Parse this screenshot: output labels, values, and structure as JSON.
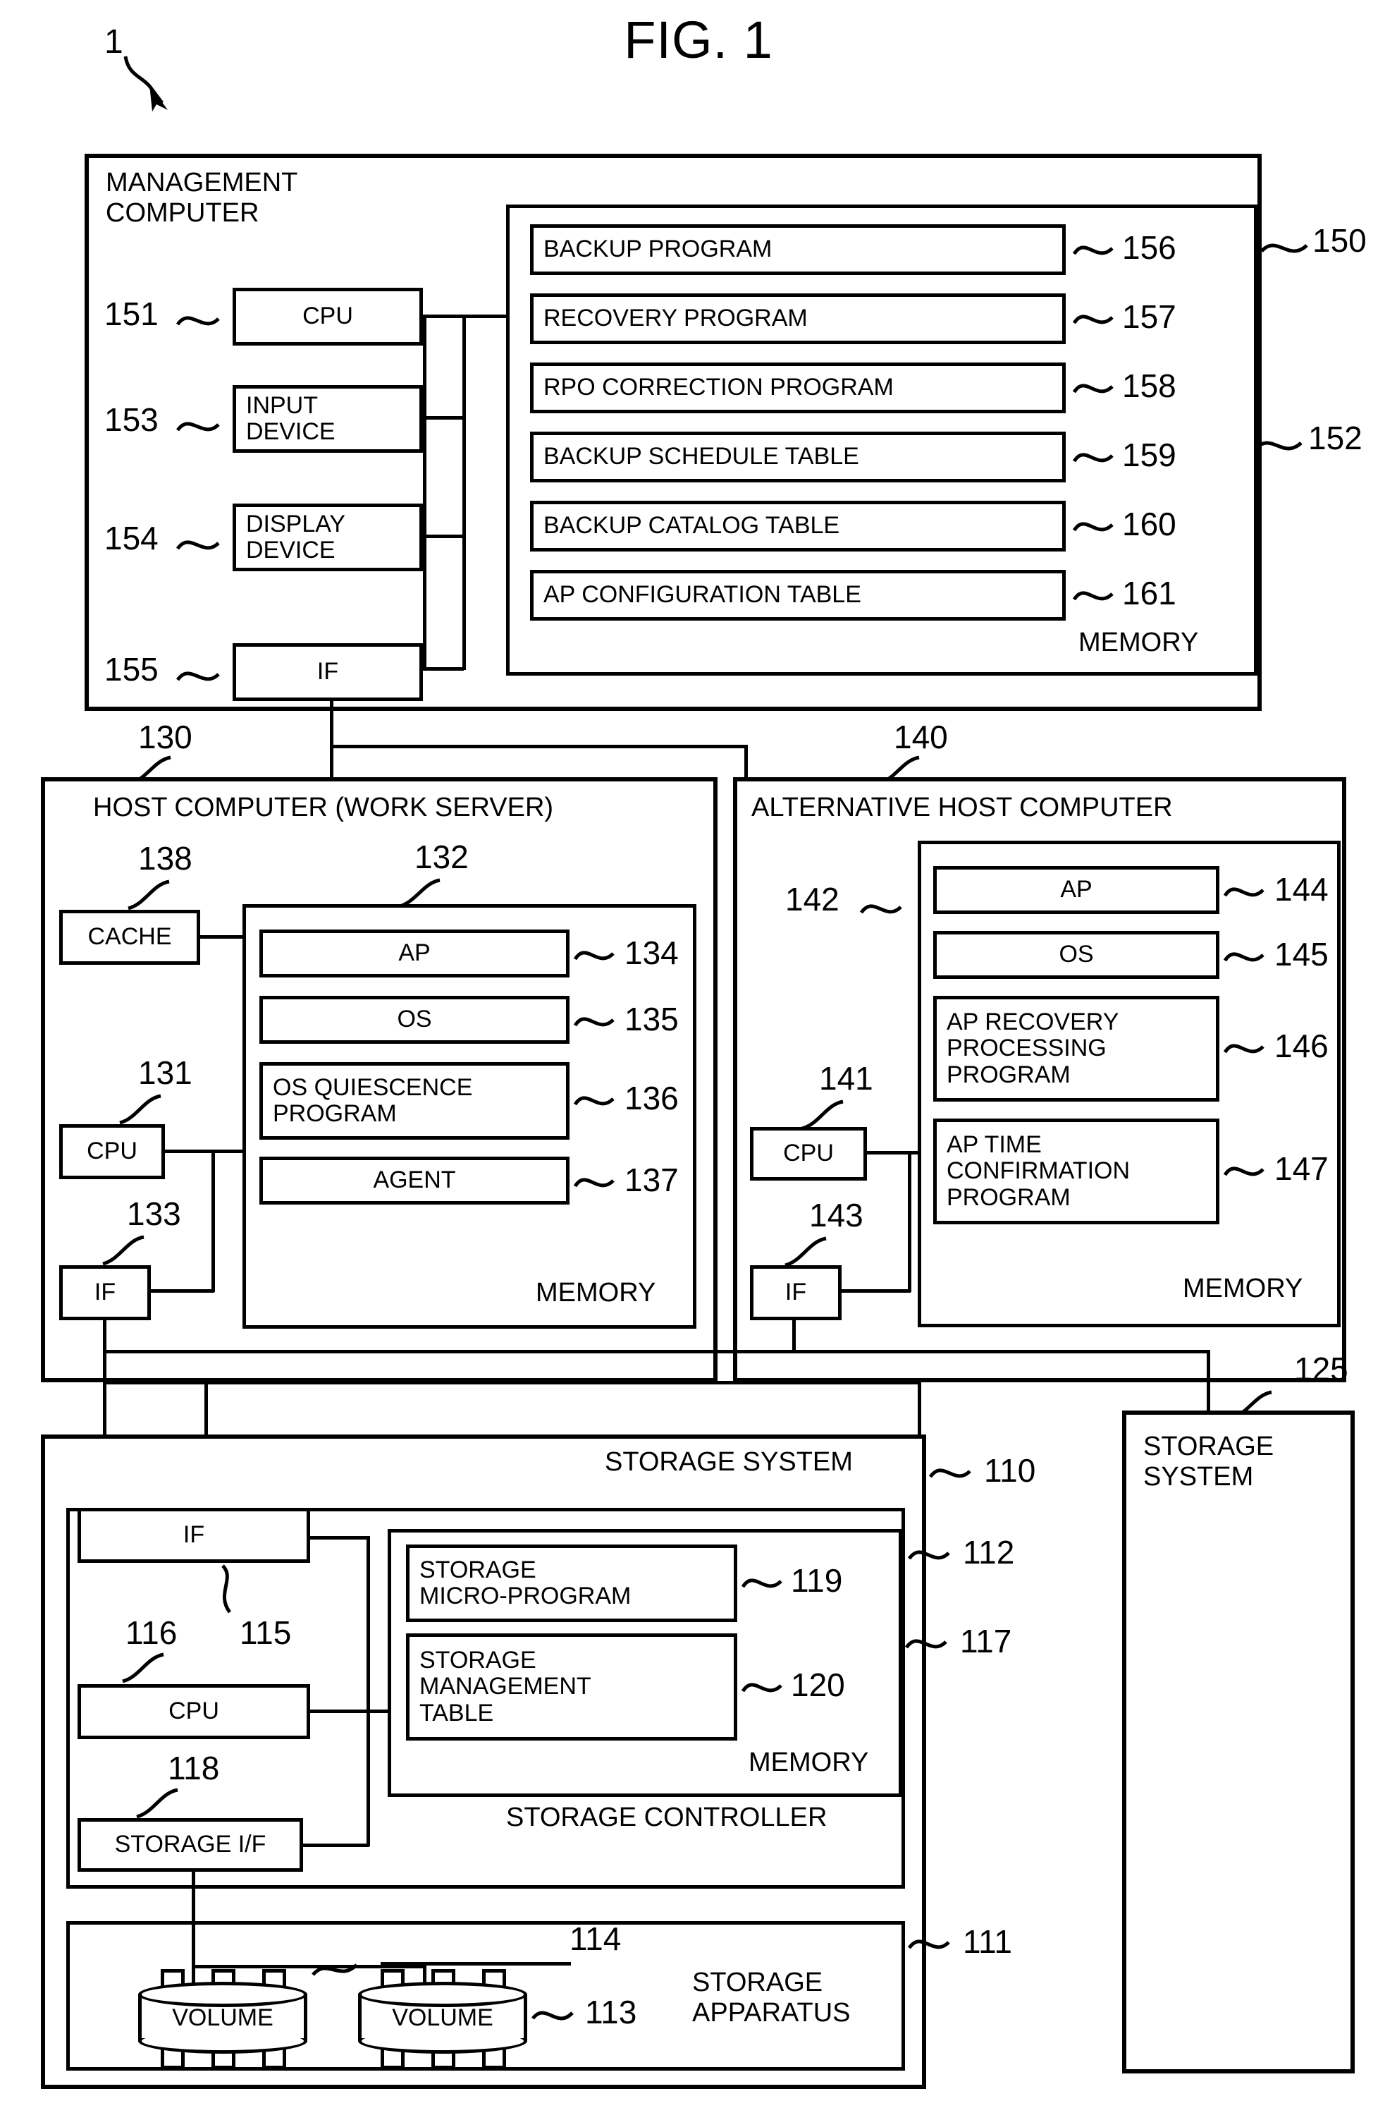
{
  "figure": {
    "title": "FIG. 1",
    "system_ref": "1"
  },
  "management_computer": {
    "title": "MANAGEMENT\nCOMPUTER",
    "ref_outer": "150",
    "ref_memory": "152",
    "memory_label": "MEMORY",
    "components": [
      {
        "label": "CPU",
        "ref": "151"
      },
      {
        "label": "INPUT\nDEVICE",
        "ref": "153"
      },
      {
        "label": "DISPLAY\nDEVICE",
        "ref": "154"
      },
      {
        "label": "IF",
        "ref": "155"
      }
    ],
    "memory_items": [
      {
        "label": "BACKUP PROGRAM",
        "ref": "156"
      },
      {
        "label": "RECOVERY PROGRAM",
        "ref": "157"
      },
      {
        "label": "RPO CORRECTION PROGRAM",
        "ref": "158"
      },
      {
        "label": "BACKUP SCHEDULE TABLE",
        "ref": "159"
      },
      {
        "label": "BACKUP CATALOG TABLE",
        "ref": "160"
      },
      {
        "label": "AP CONFIGURATION TABLE",
        "ref": "161"
      }
    ]
  },
  "host_computer": {
    "title": "HOST COMPUTER (WORK SERVER)",
    "ref_outer": "130",
    "ref_memory": "132",
    "memory_label": "MEMORY",
    "components": [
      {
        "label": "CACHE",
        "ref": "138"
      },
      {
        "label": "CPU",
        "ref": "131"
      },
      {
        "label": "IF",
        "ref": "133"
      }
    ],
    "memory_items": [
      {
        "label": "AP",
        "ref": "134"
      },
      {
        "label": "OS",
        "ref": "135"
      },
      {
        "label": "OS QUIESCENCE\nPROGRAM",
        "ref": "136"
      },
      {
        "label": "AGENT",
        "ref": "137"
      }
    ]
  },
  "alternative_host_computer": {
    "title": "ALTERNATIVE HOST COMPUTER",
    "ref_outer": "140",
    "ref_memory": "142",
    "memory_label": "MEMORY",
    "components": [
      {
        "label": "CPU",
        "ref": "141"
      },
      {
        "label": "IF",
        "ref": "143"
      }
    ],
    "memory_items": [
      {
        "label": "AP",
        "ref": "144"
      },
      {
        "label": "OS",
        "ref": "145"
      },
      {
        "label": "AP RECOVERY\nPROCESSING\nPROGRAM",
        "ref": "146"
      },
      {
        "label": "AP TIME\nCONFIRMATION\nPROGRAM",
        "ref": "147"
      }
    ]
  },
  "storage_system": {
    "title": "STORAGE SYSTEM",
    "ref_outer": "110",
    "ref_controller": "112",
    "ref_memory": "117",
    "ref_apparatus": "111",
    "controller_label": "STORAGE CONTROLLER",
    "memory_label": "MEMORY",
    "apparatus_label": "STORAGE\nAPPARATUS",
    "components": [
      {
        "label": "IF",
        "ref": "115"
      },
      {
        "label": "CPU",
        "ref": "116"
      },
      {
        "label": "STORAGE I/F",
        "ref": "118"
      }
    ],
    "memory_items": [
      {
        "label": "STORAGE\nMICRO-PROGRAM",
        "ref": "119"
      },
      {
        "label": "STORAGE\nMANAGEMENT\nTABLE",
        "ref": "120"
      }
    ],
    "volumes": [
      {
        "label": "VOLUME",
        "ref": "114"
      },
      {
        "label": "VOLUME",
        "ref": "113"
      }
    ]
  },
  "storage_system_secondary": {
    "title": "STORAGE\nSYSTEM",
    "ref_outer": "125"
  }
}
